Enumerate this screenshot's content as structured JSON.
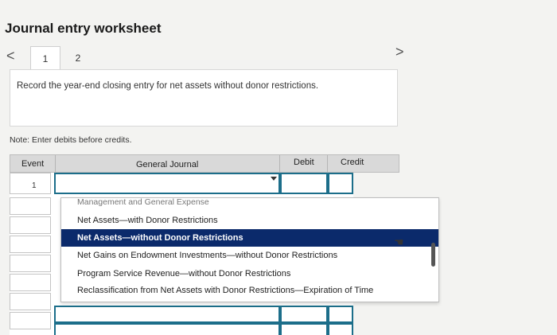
{
  "header": {
    "title": "Journal entry worksheet"
  },
  "nav": {
    "prev": "<",
    "next": ">"
  },
  "tabs": [
    {
      "label": "1"
    },
    {
      "label": "2"
    }
  ],
  "instruction": "Record the year-end closing entry for net assets without donor restrictions.",
  "note": "Note: Enter debits before credits.",
  "table": {
    "headers": {
      "event": "Event",
      "general_journal": "General Journal",
      "debit": "Debit",
      "credit": "Credit"
    },
    "rows": [
      {
        "event": "1"
      }
    ]
  },
  "dropdown": {
    "options": [
      "Management and General Expense",
      "Net Assets—with Donor Restrictions",
      "Net Assets—without Donor Restrictions",
      "Net Gains on Endowment Investments—without Donor Restrictions",
      "Program Service Revenue—without Donor Restrictions",
      "Reclassification from Net Assets with Donor Restrictions—Expiration of Time"
    ]
  },
  "colors": {
    "selected_bg": "#0b2a6b",
    "input_border": "#1c6e8a",
    "header_bg": "#d9d9d9"
  }
}
